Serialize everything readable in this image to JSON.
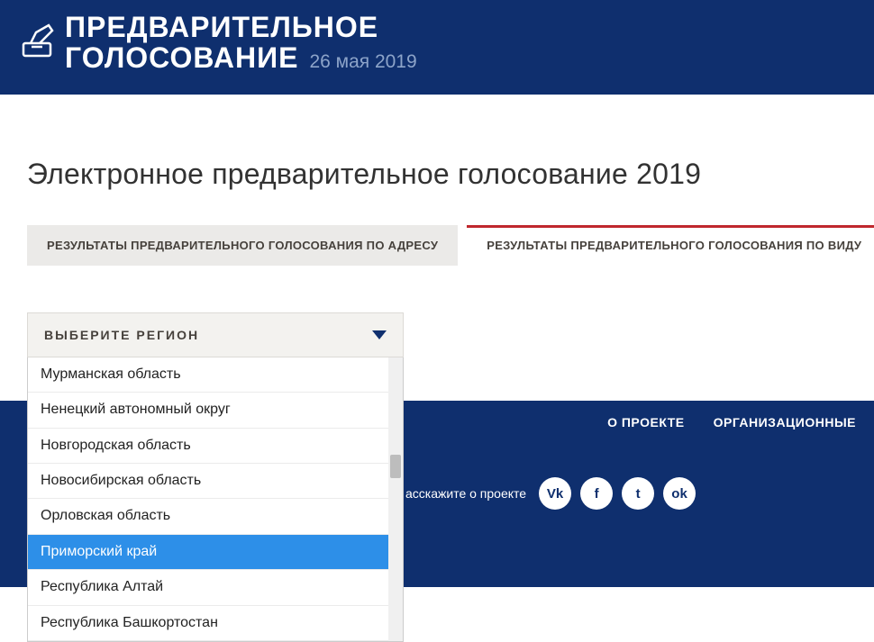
{
  "header": {
    "title_line1": "ПРЕДВАРИТЕЛЬНОЕ",
    "title_line2": "ГОЛОСОВАНИЕ",
    "date": "26 мая 2019"
  },
  "page": {
    "title": "Электронное предварительное голосование 2019"
  },
  "tabs": {
    "active": "РЕЗУЛЬТАТЫ ПРЕДВАРИТЕЛЬНОГО ГОЛОСОВАНИЯ ПО АДРЕСУ",
    "inactive": "РЕЗУЛЬТАТЫ ПРЕДВАРИТЕЛЬНОГО ГОЛОСОВАНИЯ ПО ВИДУ"
  },
  "dropdown": {
    "label": "ВЫБЕРИТЕ РЕГИОН",
    "items": [
      "Мурманская область",
      "Ненецкий автономный округ",
      "Новгородская область",
      "Новосибирская область",
      "Орловская область",
      "Приморский край",
      "Республика Алтай",
      "Республика Башкортостан"
    ],
    "selected_index": 5
  },
  "footer": {
    "link_about": "О ПРОЕКТЕ",
    "link_org": "ОРГАНИЗАЦИОННЫЕ",
    "share_label": "асскажите о проекте",
    "social": {
      "vk": "Vk",
      "fb": "f",
      "tw": "t",
      "ok": "ok"
    }
  }
}
